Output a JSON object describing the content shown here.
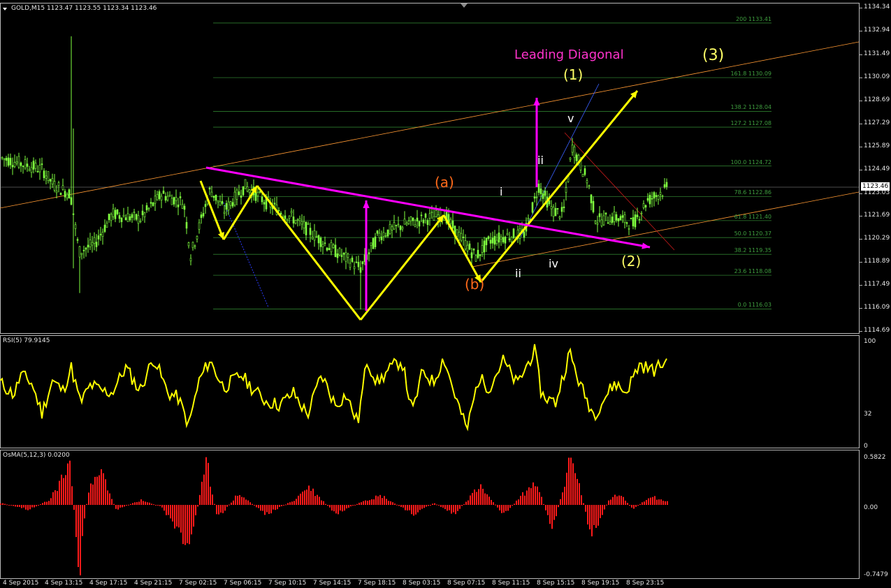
{
  "header": {
    "symbol_info": "GOLD,M15  1123.47 1123.55 1123.34 1123.46"
  },
  "price_axis": {
    "labels": [
      "1134.34",
      "1132.94",
      "1131.49",
      "1130.09",
      "1128.69",
      "1127.29",
      "1125.89",
      "1124.49",
      "1123.03",
      "1121.69",
      "1120.29",
      "1118.89",
      "1117.49",
      "1116.09",
      "1114.69"
    ],
    "current_price": "1123.46"
  },
  "time_axis": {
    "labels": [
      "4 Sep 2015",
      "4 Sep 13:15",
      "4 Sep 17:15",
      "4 Sep 21:15",
      "7 Sep 02:15",
      "7 Sep 06:15",
      "7 Sep 10:15",
      "7 Sep 14:15",
      "7 Sep 18:15",
      "8 Sep 03:15",
      "8 Sep 07:15",
      "8 Sep 11:15",
      "8 Sep 15:15",
      "8 Sep 19:15",
      "8 Sep 23:15"
    ]
  },
  "fibonacci": [
    {
      "ratio": "200",
      "price": "1133.41"
    },
    {
      "ratio": "161.8",
      "price": "1130.09"
    },
    {
      "ratio": "138.2",
      "price": "1128.04"
    },
    {
      "ratio": "127.2",
      "price": "1127.08"
    },
    {
      "ratio": "100.0",
      "price": "1124.72"
    },
    {
      "ratio": "78.6",
      "price": "1122.86"
    },
    {
      "ratio": "61.8",
      "price": "1121.40"
    },
    {
      "ratio": "50.0",
      "price": "1120.37"
    },
    {
      "ratio": "38.2",
      "price": "1119.35"
    },
    {
      "ratio": "23.6",
      "price": "1118.08"
    },
    {
      "ratio": "0.0",
      "price": "1116.03"
    }
  ],
  "annotations": {
    "leading_diagonal": "Leading Diagonal",
    "wave_1": "(1)",
    "wave_2": "(2)",
    "wave_3": "(3)",
    "wave_a": "(a)",
    "wave_b": "(b)",
    "sub_i": "i",
    "sub_ii_top": "ii",
    "sub_ii_bottom": "ii",
    "sub_iv": "iv",
    "sub_v": "v"
  },
  "rsi": {
    "title": "RSI(5) 79.9145",
    "axis": [
      "100",
      "32",
      "0"
    ]
  },
  "osma": {
    "title": "OsMA(5,12,3) 0.0200",
    "axis": [
      "0.5822",
      "0.00",
      "-0.7479"
    ]
  },
  "colors": {
    "candle": "#7fff3f",
    "fib": "#2e7d2e",
    "trendline": "#ff00ff",
    "wave_path": "#ffff00",
    "channel": "#ff9933",
    "rsi_line": "#ffff00",
    "osma_bar": "#ff1a1a",
    "grid_line": "#b8b8b8"
  }
}
